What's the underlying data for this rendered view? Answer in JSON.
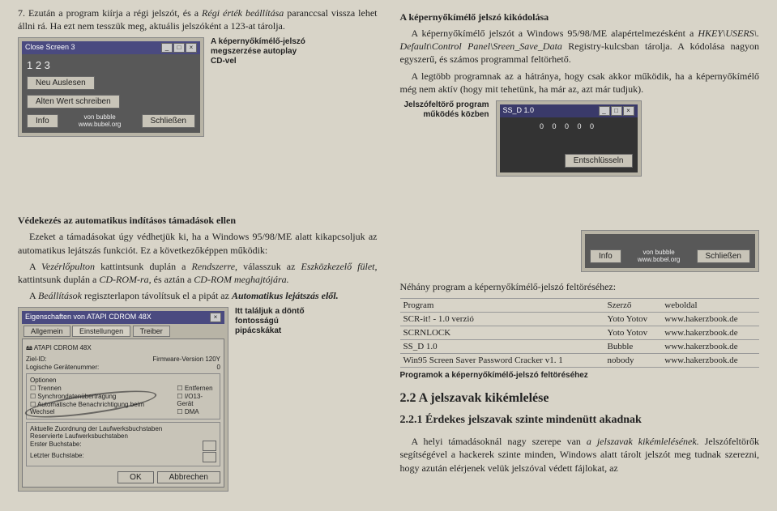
{
  "left": {
    "step7_a": "7. Ezután a program kiírja a régi jelszót, és a ",
    "step7_i1": "Régi érték beállítása",
    "step7_b": " paranccsal vissza lehet állni rá. Ha ezt nem tesszük meg, aktuális jelszóként a 123-at tárolja.",
    "fig1_title": "Close Screen 3",
    "fig1_123": "1 2 3",
    "fig1_btn1": "Neu Auslesen",
    "fig1_btn2": "Alten Wert schreiben",
    "fig1_info": "Info",
    "fig1_credit": "von bubble\nwww.bubel.org",
    "fig1_close": "Schließen",
    "fig1_caption": "A képernyőkímélő-jelszó megszerzése autoplay CD-vel",
    "def_heading": "Védekezés az automatikus indításos támadások ellen",
    "def_p1": "Ezeket a támadásokat úgy védhetjük ki, ha a Windows 95/98/ME alatt kikapcsoljuk az automatikus lejátszás funkciót. Ez a következőképpen működik:",
    "def_p2a": "A ",
    "def_p2i1": "Vezérlőpulton",
    "def_p2b": " kattintsunk duplán a ",
    "def_p2i2": "Rendszerre,",
    "def_p2c": " válasszuk az ",
    "def_p2i3": "Eszközkezelő fület,",
    "def_p2d": " kattintsunk duplán a ",
    "def_p2i4": "CD-ROM-ra,",
    "def_p2e": " és aztán a ",
    "def_p2i5": "CD-ROM meghajtójára.",
    "def_p3a": "A ",
    "def_p3i1": "Beállítások",
    "def_p3b": " regiszterlapon távolítsuk el a pipát az ",
    "def_p3i2": "Automatikus lejátszás elől.",
    "fig2_caption": "Itt találjuk a döntő fontosságú pipácskákat",
    "atapi": {
      "title": "Eigenschaften von ATAPI CDROM 48X",
      "tab1": "Allgemein",
      "tab2": "Einstellungen",
      "tab3": "Treiber",
      "name": "ATAPI CDROM 48X",
      "zielid": "Ziel-ID:",
      "fw": "Firmware-Version",
      "fwv": "120Y",
      "lun": "Logische Gerätenummer:",
      "lunv": "0",
      "opt": "Optionen",
      "c1": "Trennen",
      "c2": "Entfernen",
      "c3": "Synchrondatenübertragung",
      "c4": "I/O13-Gerät",
      "c5": "Automatische Benachrichtigung beim Wechsel",
      "c6": "DMA",
      "grp2": "Aktuelle Zuordnung der Laufwerksbuchstaben",
      "r1": "Reservierte Laufwerksbuchstaben",
      "r2": "Erster Buchstabe:",
      "r3": "Letzter Buchstabe:",
      "ok": "OK",
      "cancel": "Abbrechen"
    }
  },
  "right": {
    "title1": "A képernyőkímélő jelszó kikódolása",
    "p1a": "A képernyőkímélő jelszót a Windows 95/98/ME alapértelmezésként a ",
    "p1i1": "HKEY\\USERS\\. Default\\Control Panel\\Sreen_Save_Data",
    "p1b": " Registry-kulcsban tárolja. A kódolása nagyon egyszerű, és számos programmal feltörhető.",
    "p2": "A legtöbb programnak az a hátránya, hogy csak akkor működik, ha a képernyőkímélő még nem aktív (hogy mit tehetünk, ha már az, azt már tudjuk).",
    "fig3_caption": "Jelszófeltörő program működés közben",
    "ss_title": "SS_D 1.0",
    "ss_dots": "0 0 0 0 0",
    "ss_btn": "Entschlüsseln",
    "mini_info": "Info",
    "mini_credit": "von bubble\nwww.bobel.org",
    "mini_close": "Schließen",
    "p3": "Néhány program a képernyőkímélő-jelszó feltöréséhez:",
    "thead": {
      "c1": "Program",
      "c2": "Szerző",
      "c3": "weboldal"
    },
    "rows": [
      {
        "c1": "SCR-it! - 1.0 verzió",
        "c2": "Yoto Yotov",
        "c3": "www.hakerzbook.de"
      },
      {
        "c1": "SCRNLOCK",
        "c2": "Yoto Yotov",
        "c3": "www.hakerzbook.de"
      },
      {
        "c1": "SS_D 1.0",
        "c2": "Bubble",
        "c3": "www.hakerzbook.de"
      },
      {
        "c1": "Win95 Screen Saver Password Cracker v1. 1",
        "c2": "nobody",
        "c3": "www.hakerzbook.de"
      }
    ],
    "tablenote": "Programok a képernyőkímélő-jelszó feltöréséhez",
    "h22": "2.2 A jelszavak kikémlelése",
    "h221": "2.2.1 Érdekes jelszavak szinte mindenütt akadnak",
    "p4a": "A helyi támadásoknál nagy szerepe van ",
    "p4i": "a jelszavak kikémlelésének.",
    "p4b": " Jelszófeltörők segítségével a hackerek szinte minden, Windows alatt tárolt jelszót meg tudnak szerezni, hogy azután elérjenek velük jelszóval védett fájlokat, az"
  }
}
